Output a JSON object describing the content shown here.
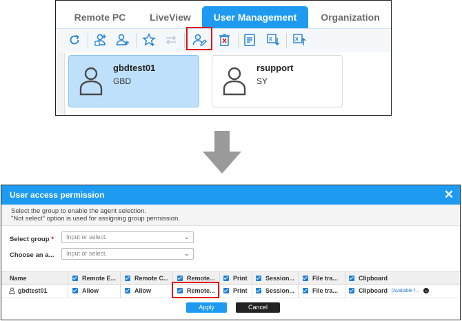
{
  "tabs": [
    {
      "label": "Remote PC"
    },
    {
      "label": "LiveView"
    },
    {
      "label": "User Management"
    },
    {
      "label": "Organization"
    }
  ],
  "toolbar_icons": [
    "refresh-icon",
    "add-user-group-icon",
    "add-user-icon",
    "favorite-icon",
    "swap-icon",
    "user-permission-icon",
    "delete-icon",
    "list-icon",
    "excel-export-icon",
    "excel-import-icon"
  ],
  "users": [
    {
      "name": "gbdtest01",
      "group": "GBD"
    },
    {
      "name": "rsupport",
      "group": "SY"
    }
  ],
  "dialog": {
    "title": "User access permission",
    "desc_line1": "Select the group to enable the agent selection.",
    "desc_line2": "\"Not select\" option is used for assigning group permission.",
    "select_group_label": "Select group",
    "select_group_placeholder": "Input or select.",
    "choose_label": "Choose an a...",
    "choose_placeholder": "Input or select.",
    "columns": {
      "name": "Name",
      "c1": "Remote E...",
      "c2": "Remote C...",
      "c3": "Remote...",
      "c4": "Print",
      "c5": "Session...",
      "c6": "File tra...",
      "c7": "Clipboard"
    },
    "row": {
      "name": "gbdtest01",
      "c1": "Allow",
      "c2": "Allow",
      "c3": "Remote...",
      "c4": "Print",
      "c5": "Session...",
      "c6": "File tra...",
      "c7": "Clipboard",
      "available": "[Available f..."
    },
    "apply_label": "Apply",
    "cancel_label": "Cancel"
  },
  "colors": {
    "accent": "#1e9bf0",
    "highlight": "#e01010",
    "selected_card": "#bfe0fb"
  }
}
